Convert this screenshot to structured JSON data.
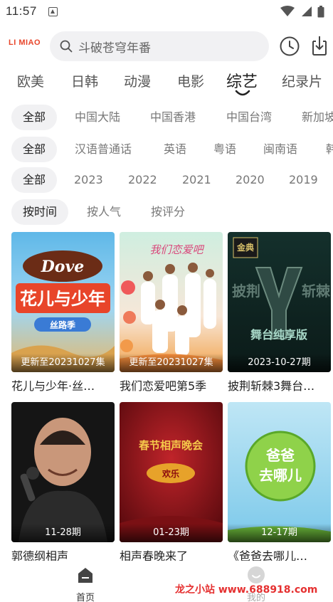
{
  "status_bar": {
    "time": "11:57"
  },
  "header": {
    "logo_text": "LI MIAO",
    "search_placeholder": "斗破苍穹年番"
  },
  "category_tabs": [
    {
      "label": "欧美",
      "active": false
    },
    {
      "label": "日韩",
      "active": false
    },
    {
      "label": "动漫",
      "active": false
    },
    {
      "label": "电影",
      "active": false
    },
    {
      "label": "综艺",
      "active": true
    },
    {
      "label": "纪录片",
      "active": false
    }
  ],
  "filters": {
    "region": [
      "全部",
      "中国大陆",
      "中国香港",
      "中国台湾",
      "新加坡"
    ],
    "language": [
      "全部",
      "汉语普通话",
      "英语",
      "粤语",
      "闽南语",
      "韩"
    ],
    "year": [
      "全部",
      "2023",
      "2022",
      "2021",
      "2020",
      "2019"
    ],
    "sort": [
      "按时间",
      "按人气",
      "按评分"
    ]
  },
  "items": [
    {
      "title": "花儿与少年·丝…",
      "badge": "更新至20231027集",
      "poster_text": "Dove 花儿与少年 丝路季"
    },
    {
      "title": "我们恋爱吧第5季",
      "badge": "更新至20231027集",
      "poster_text": "我们恋爱吧"
    },
    {
      "title": "披荆斩棘3舞台…",
      "badge": "2023-10-27期",
      "poster_text": "舞台纯享版"
    },
    {
      "title": "郭德纲相声",
      "badge": "11-28期",
      "poster_text": ""
    },
    {
      "title": "相声春晚来了",
      "badge": "01-23期",
      "poster_text": "春节相声晚会"
    },
    {
      "title": "《爸爸去哪儿…",
      "badge": "12-17期",
      "poster_text": "爸爸去哪儿"
    }
  ],
  "bottom_nav": [
    {
      "label": "首页",
      "active": true
    },
    {
      "label": "我的",
      "active": false
    }
  ],
  "watermark": "龙之小站 www.688918.com",
  "colors": {
    "accent": "#e8452a",
    "chip_bg": "#f1f1f3",
    "watermark": "#e53030"
  }
}
